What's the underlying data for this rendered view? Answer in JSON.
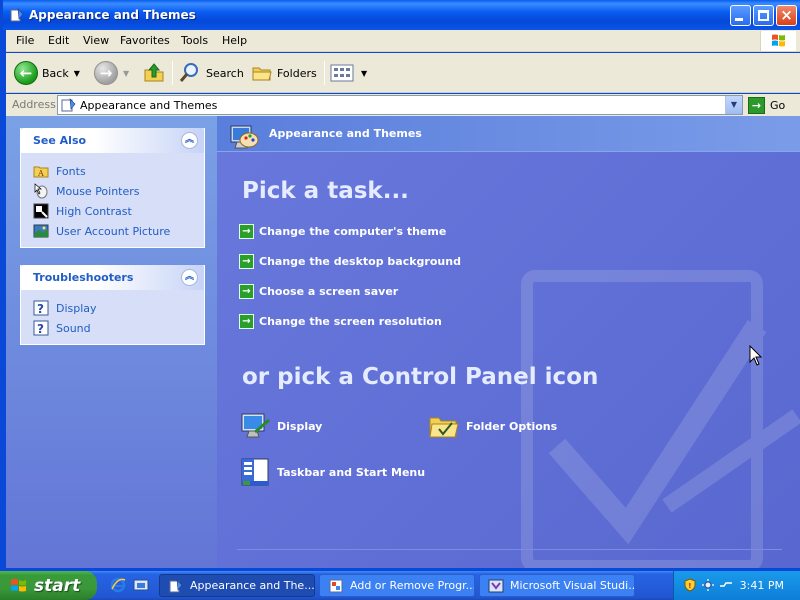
{
  "window": {
    "title": "Appearance and Themes"
  },
  "menubar": {
    "items": [
      "File",
      "Edit",
      "View",
      "Favorites",
      "Tools",
      "Help"
    ]
  },
  "toolbar": {
    "back": "Back",
    "search": "Search",
    "folders": "Folders"
  },
  "address": {
    "label": "Address",
    "value": "Appearance and Themes",
    "go": "Go"
  },
  "see_also": {
    "title": "See Also",
    "items": [
      {
        "label": "Fonts",
        "icon": "fonts-folder-icon"
      },
      {
        "label": "Mouse Pointers",
        "icon": "mouse-pointers-icon"
      },
      {
        "label": "High Contrast",
        "icon": "high-contrast-icon"
      },
      {
        "label": "User Account Picture",
        "icon": "user-account-picture-icon"
      }
    ]
  },
  "troubleshooters": {
    "title": "Troubleshooters",
    "items": [
      {
        "label": "Display",
        "icon": "help-icon"
      },
      {
        "label": "Sound",
        "icon": "help-icon"
      }
    ]
  },
  "main": {
    "header": "Appearance and Themes",
    "pick_task_title": "Pick a task...",
    "tasks": [
      "Change the computer's theme",
      "Change the desktop background",
      "Choose a screen saver",
      "Change the screen resolution"
    ],
    "or_pick_title": "or pick a Control Panel icon",
    "icons": [
      {
        "label": "Display",
        "icon": "display-icon"
      },
      {
        "label": "Folder Options",
        "icon": "folder-options-icon"
      },
      {
        "label": "Taskbar and Start Menu",
        "icon": "taskbar-start-menu-icon"
      }
    ]
  },
  "taskbar": {
    "start": "start",
    "tasks": [
      {
        "label": "Appearance and The...",
        "active": true
      },
      {
        "label": "Add or Remove Progr...",
        "active": false
      },
      {
        "label": "Microsoft Visual Studi...",
        "active": false
      }
    ],
    "clock": "3:41 PM"
  },
  "colors": {
    "titlebar": "#0a5cf0",
    "content_bg": "#6375d6",
    "link": "#215dc6",
    "start_green": "#3a9a3a"
  }
}
